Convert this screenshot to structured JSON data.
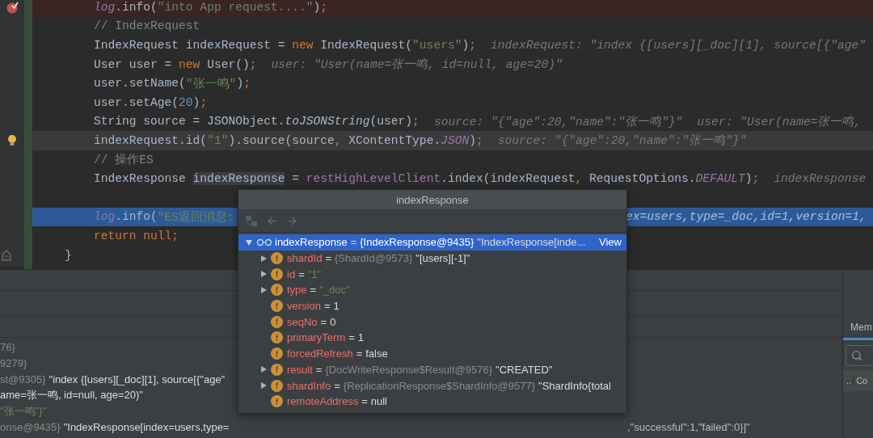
{
  "editor": {
    "lines": [
      {
        "breakpoint": true,
        "caret_line": false,
        "execution_point": false,
        "intention_bulb": false,
        "block_end": false,
        "tokens": [
          {
            "kind": "field",
            "text": "log"
          },
          {
            "kind": "plain",
            "text": ".info("
          },
          {
            "kind": "string",
            "text": "\"into App request....\""
          },
          {
            "kind": "plain",
            "text": ")"
          },
          {
            "kind": "keyword",
            "text": ";"
          }
        ]
      },
      {
        "breakpoint": false,
        "caret_line": false,
        "execution_point": false,
        "intention_bulb": false,
        "block_end": false,
        "tokens": [
          {
            "kind": "comment",
            "text": "// IndexRequest"
          }
        ]
      },
      {
        "breakpoint": false,
        "caret_line": false,
        "execution_point": false,
        "intention_bulb": false,
        "block_end": false,
        "tokens": [
          {
            "kind": "plain",
            "text": "IndexRequest indexRequest = "
          },
          {
            "kind": "keyword",
            "text": "new "
          },
          {
            "kind": "plain",
            "text": "IndexRequest("
          },
          {
            "kind": "string",
            "text": "\"users\""
          },
          {
            "kind": "plain",
            "text": ")"
          },
          {
            "kind": "keyword",
            "text": ";"
          },
          {
            "kind": "hint",
            "text": "indexRequest: \"index {[users][_doc][1], source[{\"age\""
          }
        ]
      },
      {
        "breakpoint": false,
        "caret_line": false,
        "execution_point": false,
        "intention_bulb": false,
        "block_end": false,
        "tokens": [
          {
            "kind": "plain",
            "text": "User user = "
          },
          {
            "kind": "keyword",
            "text": "new "
          },
          {
            "kind": "plain",
            "text": "User()"
          },
          {
            "kind": "keyword",
            "text": ";"
          },
          {
            "kind": "hint",
            "text": "user: \"User(name=张一鸣, id=null, age=20)\""
          }
        ]
      },
      {
        "breakpoint": false,
        "caret_line": false,
        "execution_point": false,
        "intention_bulb": false,
        "block_end": false,
        "tokens": [
          {
            "kind": "plain",
            "text": "user.setName("
          },
          {
            "kind": "string",
            "text": "\"张一鸣\""
          },
          {
            "kind": "plain",
            "text": ")"
          },
          {
            "kind": "keyword",
            "text": ";"
          }
        ]
      },
      {
        "breakpoint": false,
        "caret_line": false,
        "execution_point": false,
        "intention_bulb": false,
        "block_end": false,
        "tokens": [
          {
            "kind": "plain",
            "text": "user.setAge("
          },
          {
            "kind": "number",
            "text": "20"
          },
          {
            "kind": "plain",
            "text": ")"
          },
          {
            "kind": "keyword",
            "text": ";"
          }
        ]
      },
      {
        "breakpoint": false,
        "caret_line": false,
        "execution_point": false,
        "intention_bulb": false,
        "block_end": false,
        "tokens": [
          {
            "kind": "plain",
            "text": "String source = JSONObject."
          },
          {
            "kind": "static",
            "text": "toJSONString"
          },
          {
            "kind": "plain",
            "text": "(user)"
          },
          {
            "kind": "keyword",
            "text": ";"
          },
          {
            "kind": "hint",
            "text": "source: \"{\"age\":20,\"name\":\"张一鸣\"}\""
          },
          {
            "kind": "hint",
            "text": "user: \"User(name=张一鸣,"
          }
        ]
      },
      {
        "breakpoint": false,
        "caret_line": true,
        "execution_point": false,
        "intention_bulb": true,
        "block_end": false,
        "tokens": [
          {
            "kind": "plain",
            "text": "indexRequest.id("
          },
          {
            "kind": "string",
            "text": "\"1\""
          },
          {
            "kind": "plain",
            "text": ").source(source"
          },
          {
            "kind": "keyword",
            "text": ", "
          },
          {
            "kind": "plain",
            "text": "XContentType."
          },
          {
            "kind": "constant",
            "text": "JSON"
          },
          {
            "kind": "plain",
            "text": ")"
          },
          {
            "kind": "keyword",
            "text": ";"
          },
          {
            "kind": "hint",
            "text": "source: \"{\"age\":20,\"name\":\"张一鸣\"}\""
          }
        ]
      },
      {
        "breakpoint": false,
        "caret_line": false,
        "execution_point": false,
        "intention_bulb": false,
        "block_end": false,
        "tokens": [
          {
            "kind": "comment",
            "text": "// 操作ES"
          }
        ]
      },
      {
        "breakpoint": false,
        "caret_line": false,
        "execution_point": false,
        "intention_bulb": false,
        "block_end": false,
        "tokens": [
          {
            "kind": "plain",
            "text": "IndexResponse "
          },
          {
            "kind": "usage",
            "text": "indexResponse"
          },
          {
            "kind": "plain",
            "text": " = "
          },
          {
            "kind": "field",
            "text": "restHighLevelClient"
          },
          {
            "kind": "plain",
            "text": ".index(indexRequest"
          },
          {
            "kind": "keyword",
            "text": ", "
          },
          {
            "kind": "plain",
            "text": "RequestOptions."
          },
          {
            "kind": "constant",
            "text": "DEFAULT"
          },
          {
            "kind": "plain",
            "text": ")"
          },
          {
            "kind": "keyword",
            "text": ";"
          },
          {
            "kind": "hint",
            "text": "indexResponse"
          }
        ]
      },
      {
        "breakpoint": false,
        "caret_line": false,
        "execution_point": false,
        "intention_bulb": false
      },
      {
        "breakpoint": false,
        "caret_line": false,
        "execution_point": true,
        "intention_bulb": false,
        "block_end": false,
        "tokens": [
          {
            "kind": "field",
            "text": "log"
          },
          {
            "kind": "plain",
            "text": ".info("
          },
          {
            "kind": "string",
            "text": "\"ES返回消息:"
          }
        ],
        "tail": "ex=users,type=_doc,id=1,version=1,"
      },
      {
        "breakpoint": false,
        "caret_line": false,
        "execution_point": false,
        "intention_bulb": false,
        "block_end": false,
        "tokens": [
          {
            "kind": "keyword",
            "text": "return null;"
          }
        ]
      },
      {
        "breakpoint": false,
        "caret_line": false,
        "execution_point": false,
        "intention_bulb": false,
        "block_end": true,
        "tokens": [
          {
            "kind": "plain",
            "text": "}"
          }
        ]
      }
    ]
  },
  "variables": [
    {
      "prefix": "76}"
    },
    {
      "prefix": "9279}"
    },
    {
      "prefix": "st@9305}",
      "value": "\"index {[users][_doc][1], source[{\"age\"",
      "kind": "plain"
    },
    {
      "value": "ame=张一鸣, id=null, age=20)\"",
      "kind": "plain"
    },
    {
      "value": "\"张一鸣\"}\"",
      "kind": "string"
    },
    {
      "prefix": "onse@9435}",
      "value": "\"IndexResponse[index=users,type=",
      "kind": "plain",
      "tail": ",\"successful\":1,\"failed\":0}]\""
    }
  ],
  "side_panel": {
    "tab": "Mem",
    "column_1": "..",
    "column_2": "Co"
  },
  "popup": {
    "title": "indexResponse",
    "root": {
      "name": "indexResponse",
      "sign": "=",
      "type": "{IndexResponse@9435}",
      "value": "\"IndexResponse[inde...",
      "link": "View",
      "expanded": true,
      "selected": true
    },
    "children": [
      {
        "badge": "f",
        "name": "shardId",
        "sign": "=",
        "type": "{ShardId@9573}",
        "value": "\"[users][-1]\"",
        "kind": "plain",
        "expandable": true,
        "selected": false
      },
      {
        "badge": "f",
        "name": "id",
        "sign": "=",
        "value": "\"1\"",
        "kind": "string",
        "expandable": true,
        "selected": false
      },
      {
        "badge": "f",
        "name": "type",
        "sign": "=",
        "value": "\"_doc\"",
        "kind": "string",
        "expandable": true,
        "selected": false
      },
      {
        "badge": "f",
        "name": "version",
        "sign": "=",
        "value": "1",
        "kind": "plain",
        "expandable": false,
        "selected": false
      },
      {
        "badge": "f",
        "name": "seqNo",
        "sign": "=",
        "value": "0",
        "kind": "plain",
        "expandable": false,
        "selected": false
      },
      {
        "badge": "f",
        "name": "primaryTerm",
        "sign": "=",
        "value": "1",
        "kind": "plain",
        "expandable": false,
        "selected": false
      },
      {
        "badge": "f",
        "name": "forcedRefresh",
        "sign": "=",
        "value": "false",
        "kind": "plain",
        "expandable": false,
        "selected": false
      },
      {
        "badge": "f",
        "name": "result",
        "sign": "=",
        "type": "{DocWriteResponse$Result@9576}",
        "value": "\"CREATED\"",
        "kind": "plain",
        "expandable": true,
        "selected": false
      },
      {
        "badge": "f",
        "name": "shardInfo",
        "sign": "=",
        "type": "{ReplicationResponse$ShardInfo@9577}",
        "value": "\"ShardInfo{total",
        "kind": "plain",
        "expandable": true,
        "selected": false
      },
      {
        "badge": "f",
        "name": "remoteAddress",
        "sign": "=",
        "value": "null",
        "kind": "plain",
        "expandable": false,
        "selected": false
      }
    ]
  }
}
